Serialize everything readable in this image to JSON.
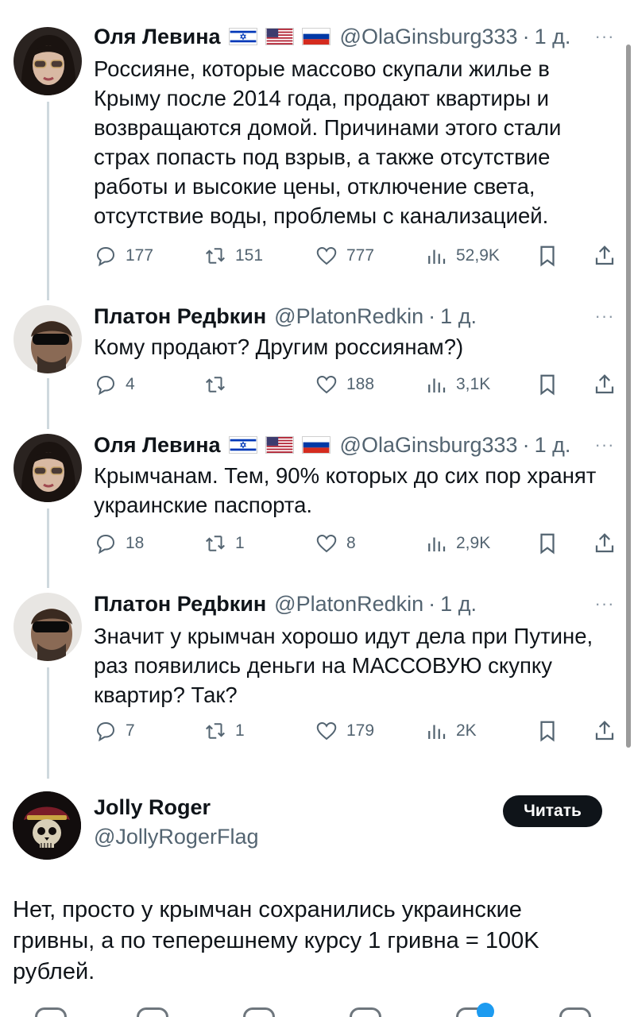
{
  "tweets": [
    {
      "name": "Оля Левина",
      "flags": [
        "israel",
        "usa",
        "russia"
      ],
      "handle": "@OlaGinsburg333",
      "time": "1 д.",
      "text": "Россияне, которые массово скупали жилье в Крыму после 2014 года, продают квартиры и возвращаются домой. Причинами этого стали страх попасть под взрыв, а также отсутствие работы и высокие цены, отключение света, отсутствие воды, проблемы с канализацией.",
      "replies": "177",
      "retweets": "151",
      "likes": "777",
      "views": "52,9K"
    },
    {
      "name": "Платон Редbкин",
      "flags": [],
      "handle": "@PlatonRedkin",
      "time": "1 д.",
      "text": "Кому продают? Другим россиянам?)",
      "replies": "4",
      "retweets": "",
      "likes": "188",
      "views": "3,1K"
    },
    {
      "name": "Оля Левина",
      "flags": [
        "israel",
        "usa",
        "russia"
      ],
      "handle": "@OlaGinsburg333",
      "time": "1 д.",
      "text": "Крымчанам. Тем, 90% которых до сих пор хранят украинские паспорта.",
      "replies": "18",
      "retweets": "1",
      "likes": "8",
      "views": "2,9K"
    },
    {
      "name": "Платон Редbкин",
      "flags": [],
      "handle": "@PlatonRedkin",
      "time": "1 д.",
      "text": "Значит у крымчан хорошо идут дела при Путине, раз появились деньги на МАССОВУЮ скупку квартир? Так?",
      "replies": "7",
      "retweets": "1",
      "likes": "179",
      "views": "2K"
    }
  ],
  "quote": {
    "name": "Jolly Roger",
    "handle": "@JollyRogerFlag",
    "follow_label": "Читать",
    "text": "Нет, просто у крымчан сохранились украинские гривны, а по теперешнему курсу 1 гривна = 100K рублей."
  },
  "colors": {
    "text": "#0f1419",
    "secondary": "#536471",
    "thread_line": "#cfd9de",
    "accent": "#1d9bf0"
  }
}
